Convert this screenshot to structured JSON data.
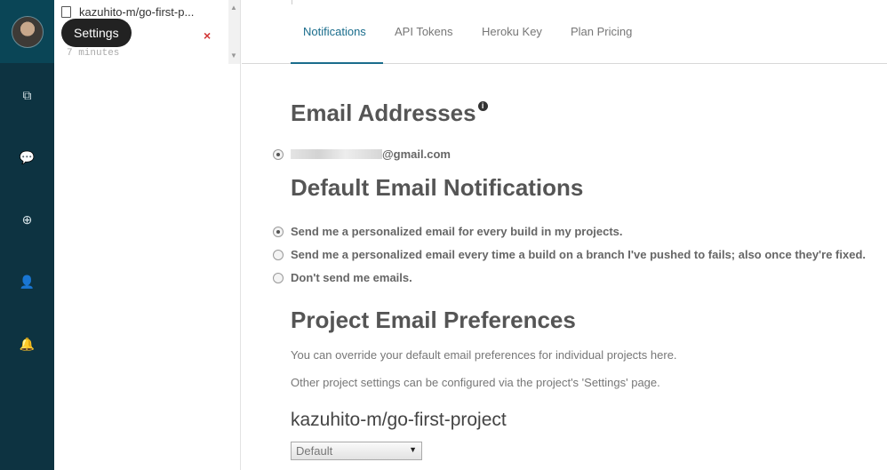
{
  "tooltip": {
    "text": "Settings"
  },
  "rail": {
    "items": [
      {
        "icon": "repositories-icon",
        "glyph": "⧉"
      },
      {
        "icon": "chat-icon",
        "glyph": "💬"
      },
      {
        "icon": "add-icon",
        "glyph": "⊕"
      },
      {
        "icon": "user-icon",
        "glyph": "👤"
      },
      {
        "icon": "bell-icon",
        "glyph": "🔔"
      }
    ]
  },
  "recent_build": {
    "repo": "kazuhito-m/go-first-p...",
    "time": "7 minutes",
    "close_glyph": "×"
  },
  "tabs": [
    "Notifications",
    "API Tokens",
    "Heroku Key",
    "Plan Pricing"
  ],
  "email_section": {
    "title": "Email Addresses",
    "info_glyph": "i",
    "email_suffix": "@gmail.com"
  },
  "default_notifications": {
    "title": "Default Email Notifications",
    "options": [
      {
        "label": "Send me a personalized email for every build in my projects.",
        "checked": true
      },
      {
        "label": "Send me a personalized email every time a build on a branch I've pushed to fails; also once they're fixed.",
        "checked": false
      },
      {
        "label": "Don't send me emails.",
        "checked": false
      }
    ]
  },
  "project_prefs": {
    "title": "Project Email Preferences",
    "description_1": "You can override your default email preferences for individual projects here.",
    "description_2": "Other project settings can be configured via the project's 'Settings' page.",
    "project_name": "kazuhito-m/go-first-project",
    "select_value": "Default",
    "select_arrow": "▼"
  },
  "colors": {
    "rail_bg": "#0d3341",
    "accent": "#1a6d8c",
    "close": "#d23636"
  }
}
